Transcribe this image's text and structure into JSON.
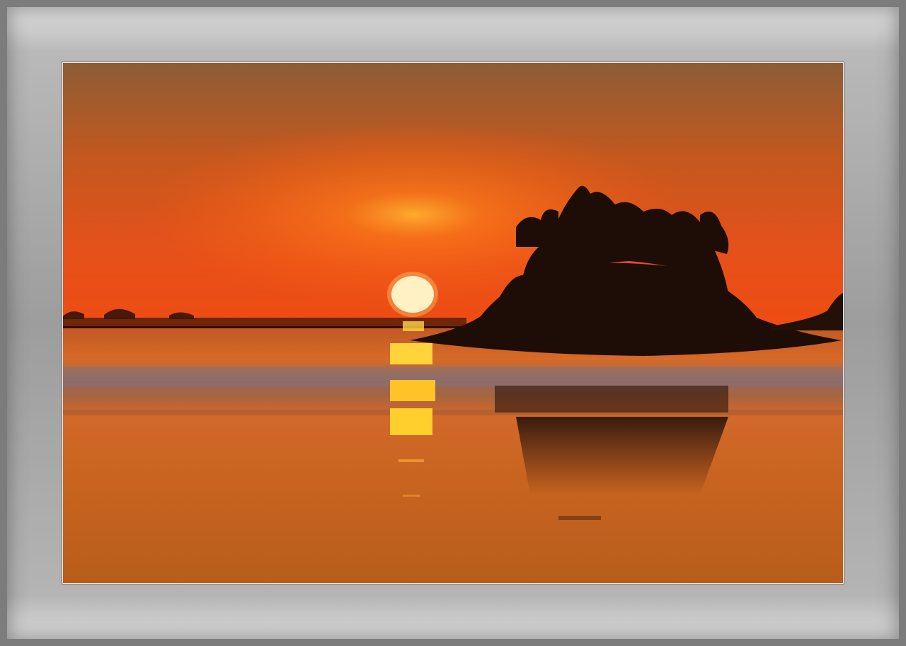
{
  "scene": {
    "sky_top_color": "#8a5a34",
    "sky_mid_color": "#e0521c",
    "sky_horizon_color": "#ee4a10",
    "water_color": "#c9631f",
    "sun_color": "#fffbe6",
    "silhouette_color": "#1e0c06"
  }
}
